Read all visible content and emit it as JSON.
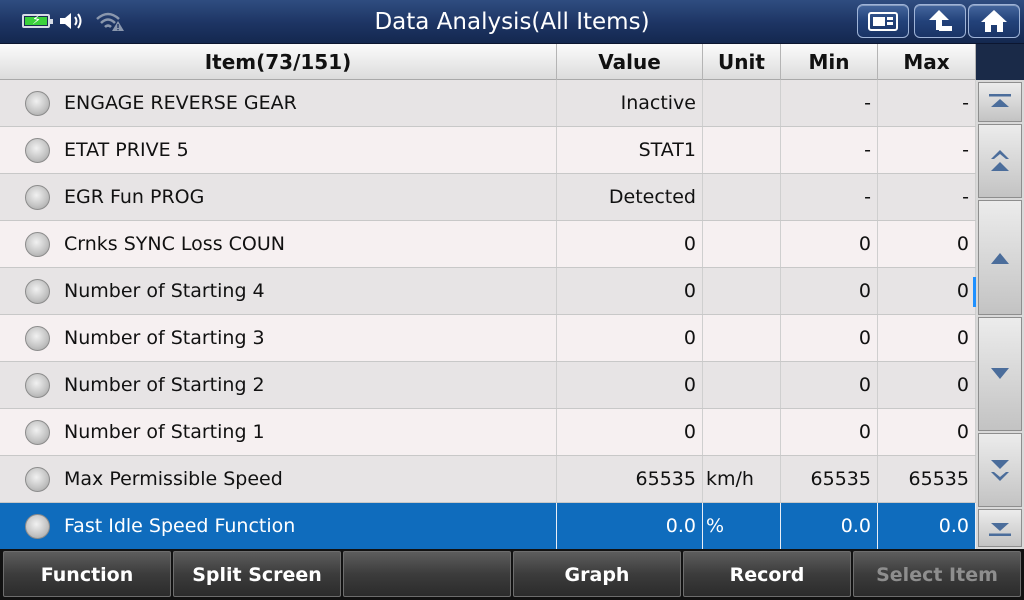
{
  "header": {
    "title": "Data Analysis(All Items)"
  },
  "table": {
    "columns": {
      "item": "Item(73/151)",
      "value": "Value",
      "unit": "Unit",
      "min": "Min",
      "max": "Max"
    },
    "rows": [
      {
        "item": "ENGAGE REVERSE GEAR",
        "value": "Inactive",
        "unit": "",
        "min": "-",
        "max": "-"
      },
      {
        "item": "ETAT PRIVE 5",
        "value": "STAT1",
        "unit": "",
        "min": "-",
        "max": "-"
      },
      {
        "item": "EGR Fun PROG",
        "value": "Detected",
        "unit": "",
        "min": "-",
        "max": "-"
      },
      {
        "item": "Crnks SYNC Loss COUN",
        "value": "0",
        "unit": "",
        "min": "0",
        "max": "0"
      },
      {
        "item": "Number of Starting 4",
        "value": "0",
        "unit": "",
        "min": "0",
        "max": "0"
      },
      {
        "item": "Number of Starting 3",
        "value": "0",
        "unit": "",
        "min": "0",
        "max": "0"
      },
      {
        "item": "Number of Starting 2",
        "value": "0",
        "unit": "",
        "min": "0",
        "max": "0"
      },
      {
        "item": "Number of Starting 1",
        "value": "0",
        "unit": "",
        "min": "0",
        "max": "0"
      },
      {
        "item": "Max Permissible Speed",
        "value": "65535",
        "unit": "km/h",
        "min": "65535",
        "max": "65535"
      },
      {
        "item": "Fast Idle Speed Function",
        "value": "0.0",
        "unit": "%",
        "min": "0.0",
        "max": "0.0"
      }
    ],
    "selected_row": 9
  },
  "toolbar": {
    "function": "Function",
    "split_screen": "Split Screen",
    "empty": "",
    "graph": "Graph",
    "record": "Record",
    "select_item": "Select Item"
  },
  "colors": {
    "selected_row": "#0f6cbd",
    "titlebar": "#1d3463",
    "battery_fill": "#3bd13b"
  },
  "icons": {
    "status": [
      "battery-charging-icon",
      "speaker-icon",
      "wifi-warning-icon"
    ],
    "header_buttons": [
      "screenshot-icon",
      "back-icon",
      "home-icon"
    ],
    "scroll": [
      "scroll-top-icon",
      "page-up-icon",
      "line-up-icon",
      "line-down-icon",
      "page-down-icon",
      "scroll-bottom-icon"
    ]
  }
}
